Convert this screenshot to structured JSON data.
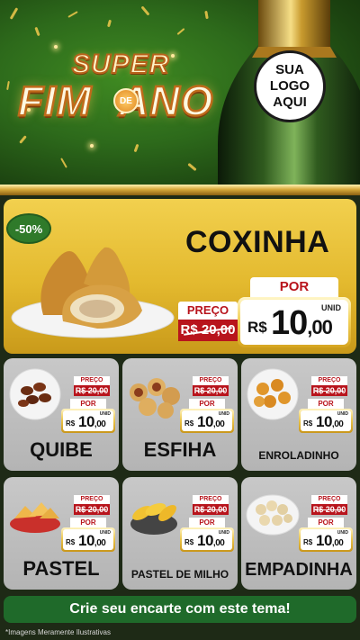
{
  "header": {
    "logo_super": "SUPER",
    "logo_fim": "FIM",
    "logo_de": "DE",
    "logo_ano": "ANO",
    "store_logo": [
      "SUA",
      "LOGO",
      "AQUI"
    ]
  },
  "featured": {
    "discount": "-50%",
    "name": "COXINHA",
    "preco_label": "PREÇO",
    "old_price": "R$ 20,00",
    "por_label": "POR",
    "unit": "UNID",
    "currency": "R$",
    "price_int": "10",
    "price_dec": ",00"
  },
  "products": [
    {
      "name": "QUIBE",
      "preco_label": "PREÇO",
      "old_price": "R$ 20,00",
      "por_label": "POR",
      "unit": "UNID",
      "currency": "R$",
      "price_int": "10",
      "price_dec": ",00"
    },
    {
      "name": "ESFIHA",
      "preco_label": "PREÇO",
      "old_price": "R$ 20,00",
      "por_label": "POR",
      "unit": "UNID",
      "currency": "R$",
      "price_int": "10",
      "price_dec": ",00"
    },
    {
      "name": "ENROLADINHO",
      "preco_label": "PREÇO",
      "old_price": "R$ 20,00",
      "por_label": "POR",
      "unit": "UNID",
      "currency": "R$",
      "price_int": "10",
      "price_dec": ",00"
    },
    {
      "name": "PASTEL",
      "preco_label": "PREÇO",
      "old_price": "R$ 20,00",
      "por_label": "POR",
      "unit": "UNID",
      "currency": "R$",
      "price_int": "10",
      "price_dec": ",00"
    },
    {
      "name": "PASTEL DE MILHO",
      "preco_label": "PREÇO",
      "old_price": "R$ 20,00",
      "por_label": "POR",
      "unit": "UNID",
      "currency": "R$",
      "price_int": "10",
      "price_dec": ",00"
    },
    {
      "name": "EMPADINHA",
      "preco_label": "PREÇO",
      "old_price": "R$ 20,00",
      "por_label": "POR",
      "unit": "UNID",
      "currency": "R$",
      "price_int": "10",
      "price_dec": ",00"
    }
  ],
  "cta": "Crie seu encarte com este tema!",
  "footnote": "*Imagens Meramente Ilustrativas",
  "colors": {
    "header_green": "#2d6a1b",
    "gold": "#e3b92e",
    "price_red": "#b8141c",
    "card_gray": "#c0c0c0",
    "cta_green": "#1f6a2a"
  }
}
